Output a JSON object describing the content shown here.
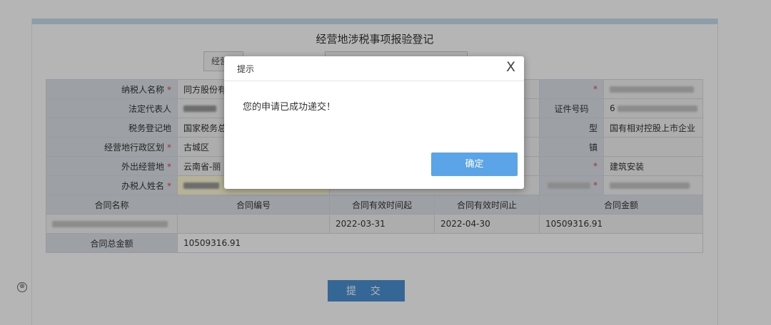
{
  "form": {
    "title": "经营地涉税事项报验登记",
    "tabs": [
      "经营",
      ""
    ],
    "rows": [
      {
        "label": "纳税人名称",
        "required": true,
        "value": "同方股份有",
        "label2": "",
        "required2": true,
        "value2": ""
      },
      {
        "label": "法定代表人",
        "required": false,
        "value": "",
        "label2": "证件号码",
        "required2": false,
        "value2": "6"
      },
      {
        "label": "税务登记地",
        "required": false,
        "value": "国家税务总",
        "label2": "型",
        "required2": false,
        "value2": "国有相对控股上市企业"
      },
      {
        "label": "经营地行政区划",
        "required": true,
        "value": "古城区",
        "label2": "镇",
        "required2": false,
        "value2": ""
      },
      {
        "label": "外出经营地",
        "required": true,
        "value": "云南省-丽",
        "label2": "",
        "required2": true,
        "value2": "建筑安装"
      },
      {
        "label": "办税人姓名",
        "required": true,
        "value": "",
        "label2": "",
        "required2": true,
        "value2": ""
      }
    ],
    "contract_headers": [
      "合同名称",
      "合同编号",
      "合同有效时间起",
      "合同有效时间止",
      "合同金额"
    ],
    "contract_rows": [
      {
        "name": "",
        "number": "",
        "start": "2022-03-31",
        "end": "2022-04-30",
        "amount": "10509316.91"
      }
    ],
    "total_label": "合同总金额",
    "total_value": "10509316.91",
    "submit_label": "提 交"
  },
  "dialog": {
    "title": "提示",
    "close_label": "X",
    "message": "您的申请已成功递交！",
    "ok_label": "确定"
  },
  "side": {
    "close_icon": "⊗"
  },
  "colors": {
    "primary_button": "#4a90d4",
    "dialog_ok": "#5ba4e8",
    "label_bg": "#dde3ea",
    "required": "#e04848",
    "overlay": "rgba(0,0,0,0.29)"
  }
}
